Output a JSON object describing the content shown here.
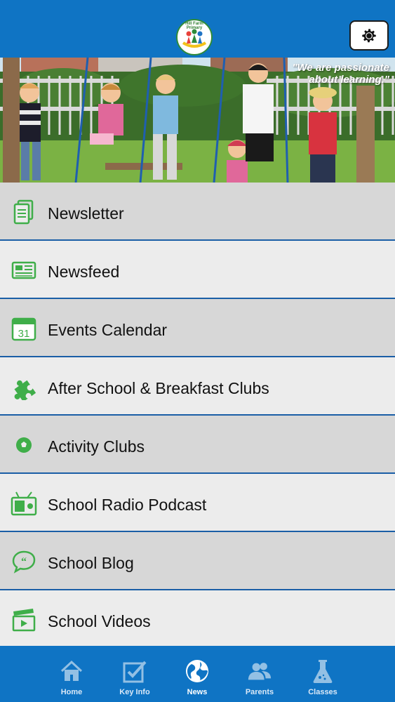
{
  "header": {
    "logo_text": "Hill Farm Primary",
    "settings_icon": "gear-icon",
    "bg_color": "#0f74c4"
  },
  "banner": {
    "tagline": "\"We are passionate about learning.\""
  },
  "menu": {
    "items": [
      {
        "label": "Newsletter",
        "icon": "document-icon"
      },
      {
        "label": "Newsfeed",
        "icon": "newspaper-icon"
      },
      {
        "label": "Events Calendar",
        "icon": "calendar-icon",
        "icon_text": "31"
      },
      {
        "label": "After School & Breakfast Clubs",
        "icon": "puzzle-icon"
      },
      {
        "label": "Activity Clubs",
        "icon": "football-icon"
      },
      {
        "label": "School Radio Podcast",
        "icon": "radio-icon"
      },
      {
        "label": "School Blog",
        "icon": "chat-bubble-icon"
      },
      {
        "label": "School Videos",
        "icon": "clapperboard-icon"
      }
    ],
    "icon_color": "#3fae49",
    "divider_color": "#1a5ea6"
  },
  "tabbar": {
    "tabs": [
      {
        "label": "Home",
        "icon": "home-icon",
        "active": false
      },
      {
        "label": "Key Info",
        "icon": "checkbox-icon",
        "active": false
      },
      {
        "label": "News",
        "icon": "globe-icon",
        "active": true
      },
      {
        "label": "Parents",
        "icon": "people-icon",
        "active": false
      },
      {
        "label": "Classes",
        "icon": "flask-icon",
        "active": false
      }
    ]
  }
}
